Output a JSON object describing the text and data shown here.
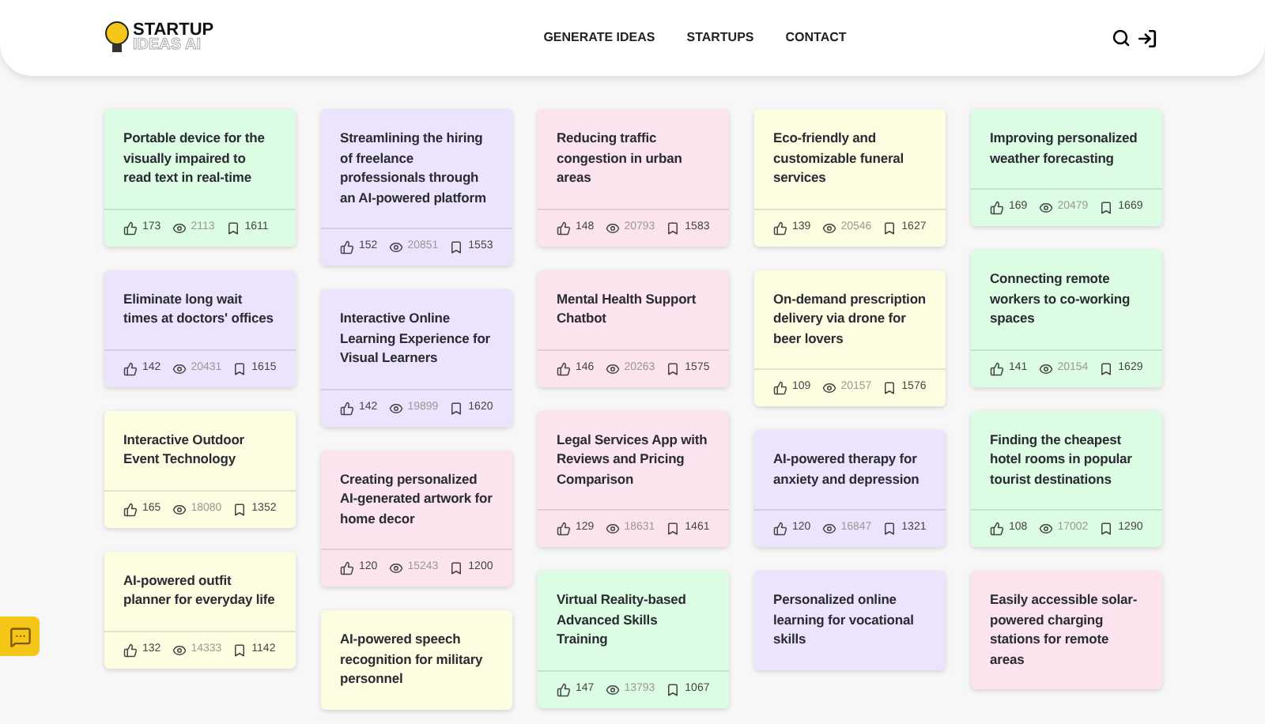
{
  "header": {
    "logo": {
      "line_1": "STARTUP",
      "line_2": "IDEAS AI"
    },
    "nav": [
      {
        "label": "GENERATE IDEAS"
      },
      {
        "label": "STARTUPS"
      },
      {
        "label": "CONTACT"
      }
    ]
  },
  "columns": [
    {
      "cards": [
        {
          "title": "Portable device for the visually impaired to read text in real-time",
          "color": "#dcfce3",
          "likes": "173",
          "views": "2113",
          "saves": "1611"
        },
        {
          "title": "Eliminate long wait times at doctors' offices",
          "color": "#ebe4fc",
          "likes": "142",
          "views": "20431",
          "saves": "1615"
        },
        {
          "title": "Interactive Outdoor Event Technology",
          "color": "#fdfde2",
          "likes": "165",
          "views": "18080",
          "saves": "1352"
        },
        {
          "title": "AI-powered outfit planner for everyday life",
          "color": "#fdfde2",
          "likes": "132",
          "views": "14333",
          "saves": "1142"
        }
      ]
    },
    {
      "cards": [
        {
          "title": "Streamlining the hiring of freelance professionals through an AI-powered platform",
          "color": "#ebe4fc",
          "likes": "152",
          "views": "20851",
          "saves": "1553"
        },
        {
          "title": "Interactive Online Learning Experience for Visual Learners",
          "color": "#ebe4fc",
          "likes": "142",
          "views": "19899",
          "saves": "1620"
        },
        {
          "title": "Creating personalized AI-generated artwork for home decor",
          "color": "#fbe4ee",
          "likes": "120",
          "views": "15243",
          "saves": "1200"
        },
        {
          "title": "AI-powered speech recognition for military personnel",
          "color": "#fdfde2"
        }
      ]
    },
    {
      "cards": [
        {
          "title": "Reducing traffic congestion in urban areas",
          "color": "#fbe4ee",
          "likes": "148",
          "views": "20793",
          "saves": "1583"
        },
        {
          "title": "Mental Health Support Chatbot",
          "color": "#fbe4ee",
          "likes": "146",
          "views": "20263",
          "saves": "1575"
        },
        {
          "title": "Legal Services App with Reviews and Pricing Comparison",
          "color": "#fbe4ee",
          "likes": "129",
          "views": "18631",
          "saves": "1461"
        },
        {
          "title": "Virtual Reality-based Advanced Skills Training",
          "color": "#dcfce3",
          "likes": "147",
          "views": "13793",
          "saves": "1067"
        }
      ]
    },
    {
      "cards": [
        {
          "title": "Eco-friendly and customizable funeral services",
          "color": "#fdfde2",
          "likes": "139",
          "views": "20546",
          "saves": "1627"
        },
        {
          "title": "On-demand prescription delivery via drone for beer lovers",
          "color": "#fdfde2",
          "likes": "109",
          "views": "20157",
          "saves": "1576"
        },
        {
          "title": "AI-powered therapy for anxiety and depression",
          "color": "#ebe4fc",
          "likes": "120",
          "views": "16847",
          "saves": "1321"
        },
        {
          "title": "Personalized online learning for vocational skills",
          "color": "#ebe4fc"
        }
      ]
    },
    {
      "cards": [
        {
          "title": "Improving personalized weather forecasting",
          "color": "#dcfce3",
          "likes": "169",
          "views": "20479",
          "saves": "1669"
        },
        {
          "title": "Connecting remote workers to co-working spaces",
          "color": "#dcfce3",
          "likes": "141",
          "views": "20154",
          "saves": "1629"
        },
        {
          "title": "Finding the cheapest hotel rooms in popular tourist destinations",
          "color": "#dcfce3",
          "likes": "108",
          "views": "17002",
          "saves": "1290"
        },
        {
          "title": "Easily accessible solar-powered charging stations for remote areas",
          "color": "#fbe4ee"
        }
      ]
    }
  ]
}
